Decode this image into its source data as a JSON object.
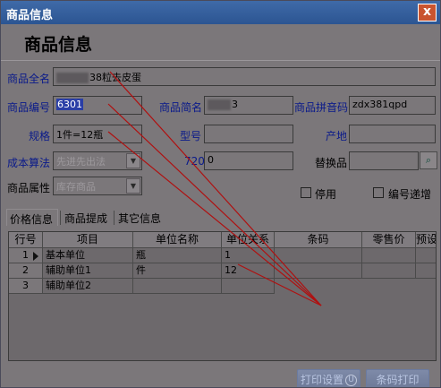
{
  "window": {
    "title": "商品信息",
    "close_label": "x"
  },
  "header": {
    "title": "商品信息"
  },
  "fields": {
    "full_name": {
      "label": "商品全名",
      "value": "38粒去皮蛋"
    },
    "code": {
      "label": "商品编号",
      "value": "6301"
    },
    "short_name": {
      "label": "商品简名",
      "value": "3"
    },
    "pinyin": {
      "label": "商品拼音码",
      "value": "zdx381qpd"
    },
    "spec": {
      "label": "规格",
      "value": "1件=12瓶"
    },
    "model": {
      "label": "型号",
      "value": ""
    },
    "origin": {
      "label": "产地",
      "value": ""
    },
    "cost_method": {
      "label": "成本算法",
      "value": "先进先出法"
    },
    "num720": {
      "label": "720",
      "value": "0"
    },
    "substitute": {
      "label": "替换品",
      "value": ""
    },
    "attribute": {
      "label": "商品属性",
      "value": "库存商品"
    }
  },
  "checkboxes": {
    "disable": "停用",
    "auto_increment": "编号递增"
  },
  "tabs": [
    "价格信息",
    "商品提成",
    "其它信息"
  ],
  "grid": {
    "columns": [
      "行号",
      "项目",
      "单位名称",
      "单位关系",
      "条码",
      "零售价",
      "预设"
    ],
    "rows": [
      {
        "num": "1",
        "item": "基本单位",
        "unit": "瓶",
        "relation": "1"
      },
      {
        "num": "2",
        "item": "辅助单位1",
        "unit": "件",
        "relation": "12"
      },
      {
        "num": "3",
        "item": "辅助单位2",
        "unit": "",
        "relation": ""
      }
    ]
  },
  "buttons": {
    "print_setup": "打印设置",
    "print_setup_key": "U",
    "barcode_print": "条码打印"
  },
  "icons": {
    "close": "close-icon",
    "search": "search-icon",
    "dropdown": "chevron-down-icon",
    "row_pointer": "row-pointer-icon"
  },
  "colors": {
    "titlebar": "#2c5592",
    "label_blue": "#0a1a8a",
    "annotation": "#b01010",
    "close_button": "#c9542f"
  }
}
